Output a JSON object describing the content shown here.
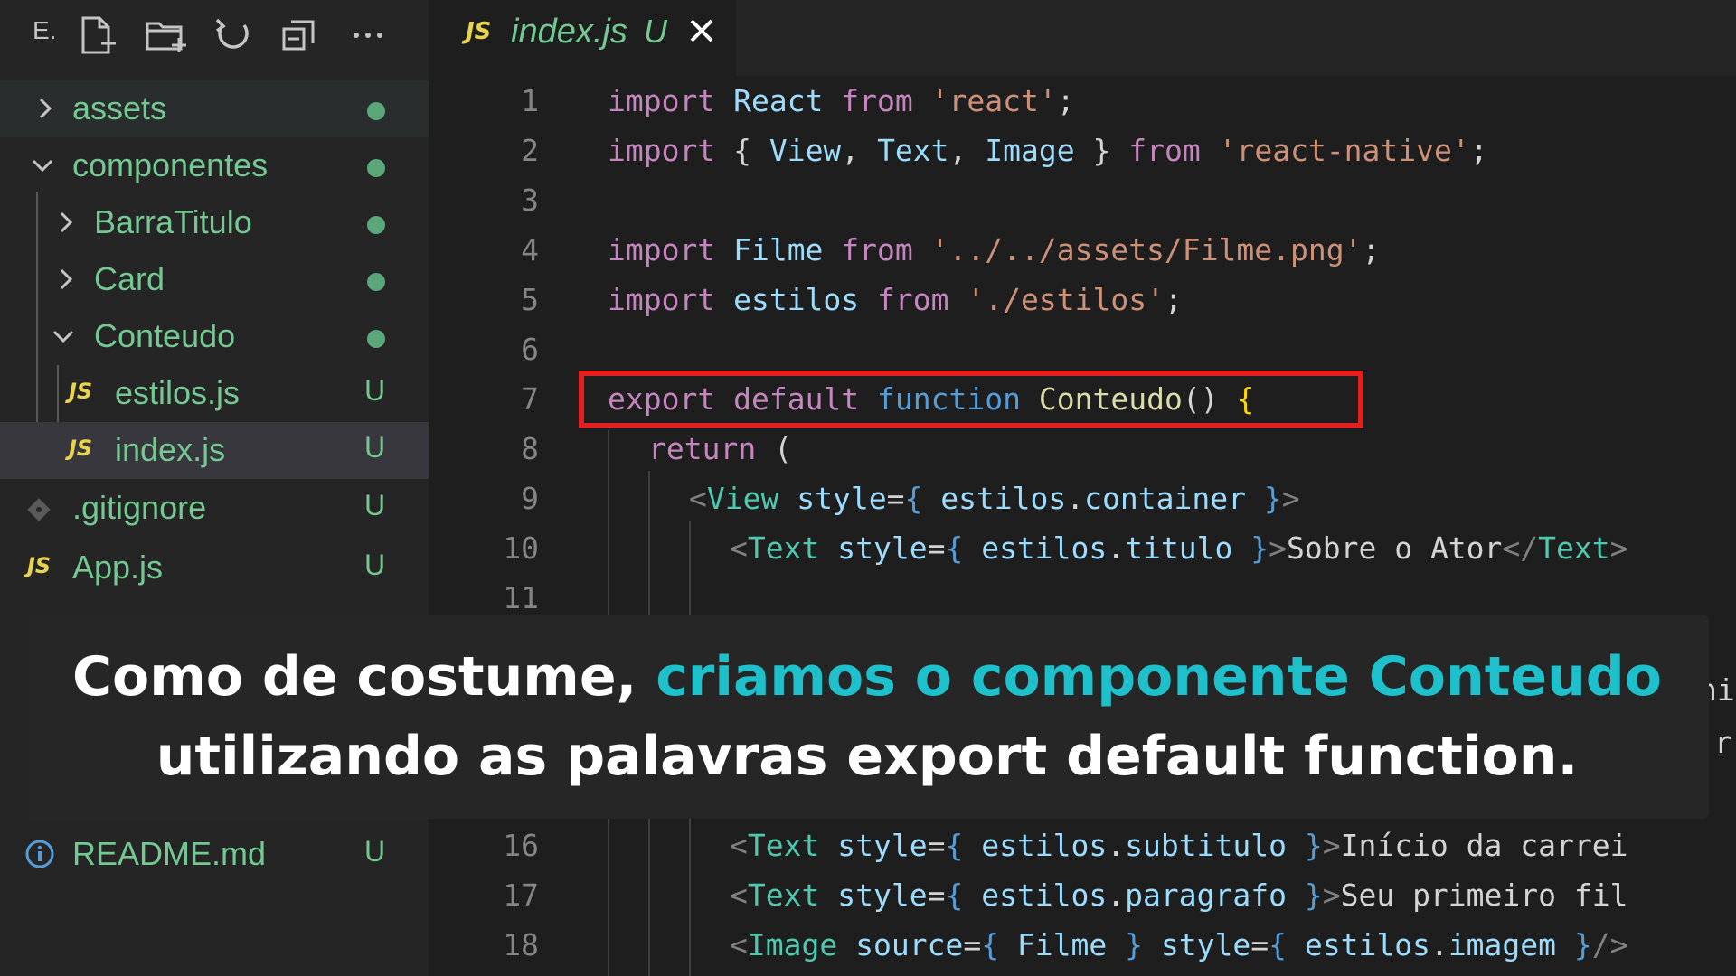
{
  "sidebar": {
    "toolbar_label": "E.",
    "toolbar_icons": [
      "new-file-icon",
      "new-folder-icon",
      "refresh-icon",
      "collapse-all-icon",
      "more-icon"
    ],
    "items": [
      {
        "name": "assets",
        "type": "folder",
        "state": "collapsed",
        "status": "dot"
      },
      {
        "name": "componentes",
        "type": "folder",
        "state": "expanded",
        "status": "dot"
      },
      {
        "name": "BarraTitulo",
        "type": "folder",
        "state": "collapsed",
        "status": "dot"
      },
      {
        "name": "Card",
        "type": "folder",
        "state": "collapsed",
        "status": "dot"
      },
      {
        "name": "Conteudo",
        "type": "folder",
        "state": "expanded",
        "status": "dot"
      },
      {
        "name": "estilos.js",
        "type": "js",
        "icon": "JS",
        "status": "U"
      },
      {
        "name": "index.js",
        "type": "js",
        "icon": "JS",
        "status": "U",
        "selected": true
      },
      {
        "name": ".gitignore",
        "type": "git",
        "status": "U"
      },
      {
        "name": "App.js",
        "type": "js",
        "icon": "JS",
        "status": "U"
      },
      {
        "name": "README.md",
        "type": "info",
        "status": "U"
      }
    ]
  },
  "tab": {
    "icon": "JS",
    "name": "index.js",
    "status": "U",
    "close": "×"
  },
  "editor": {
    "line_numbers": [
      "1",
      "2",
      "3",
      "4",
      "5",
      "6",
      "7",
      "8",
      "9",
      "10",
      "11",
      "16",
      "17",
      "18"
    ],
    "lines": {
      "l1": [
        "import",
        " React ",
        "from",
        " 'react'",
        ";"
      ],
      "l2": [
        "import",
        " { ",
        "View",
        ", ",
        "Text",
        ", ",
        "Image",
        " } ",
        "from",
        " 'react-native'",
        ";"
      ],
      "l4": [
        "import",
        " Filme ",
        "from",
        " '../../assets/Filme.png'",
        ";"
      ],
      "l5": [
        "import",
        " estilos ",
        "from",
        " './estilos'",
        ";"
      ],
      "l7": [
        "export",
        " ",
        "default",
        " ",
        "function",
        " ",
        "Conteudo",
        "()",
        " ",
        "{"
      ],
      "l8": [
        "return",
        " ("
      ],
      "l9": [
        "<",
        "View",
        " ",
        "style",
        "=",
        "{",
        " estilos",
        ".",
        "container",
        " ",
        "}",
        ">"
      ],
      "l10": [
        "<",
        "Text",
        " ",
        "style",
        "=",
        "{",
        " estilos",
        ".",
        "titulo",
        " ",
        "}",
        ">",
        "Sobre o Ator",
        "</",
        "Text",
        ">"
      ],
      "l16": [
        "<",
        "Text",
        " ",
        "style",
        "=",
        "{",
        " estilos",
        ".",
        "subtitulo",
        " ",
        "}",
        ">",
        "Início da carrei"
      ],
      "l17": [
        "<",
        "Text",
        " ",
        "style",
        "=",
        "{",
        " estilos",
        ".",
        "paragrafo",
        " ",
        "}",
        ">",
        "Seu primeiro fil"
      ],
      "l18": [
        "<",
        "Image",
        " ",
        "source",
        "=",
        "{",
        " Filme ",
        "}",
        " ",
        "style",
        "=",
        "{",
        " estilos",
        ".",
        "imagem",
        " ",
        "}",
        "/>"
      ]
    },
    "obscured_fragments": [
      "ni",
      "r"
    ]
  },
  "caption": {
    "line1_a": "Como de costume, ",
    "line1_highlight": "criamos o componente Conteudo",
    "line2": "utilizando as palavras export default function."
  },
  "colors": {
    "highlight_border": "#e41f1f",
    "caption_accent": "#1ec0cc",
    "git_untracked": "#73c991"
  }
}
